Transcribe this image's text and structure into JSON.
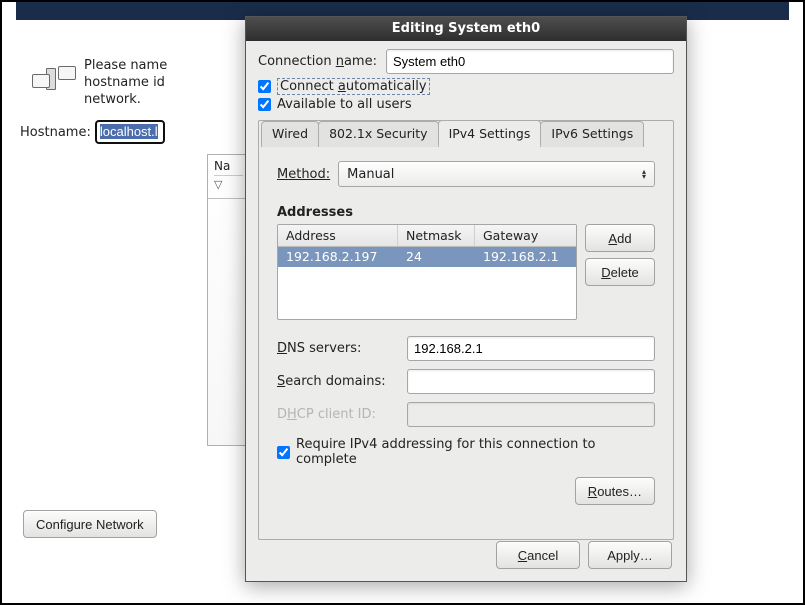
{
  "installer": {
    "text_line1": "Please name",
    "text_line2": "hostname id",
    "text_line3": "network.",
    "hostname_label": "Hostname:",
    "hostname_value": "localhost.l",
    "configure_btn": "Configure Network",
    "subwin_head1": "Na",
    "subwin_head2": "▽"
  },
  "dialog": {
    "title": "Editing System eth0",
    "conn_name_label": "Connection name:",
    "conn_name_value": "System eth0",
    "connect_auto_label": "Connect automatically",
    "connect_auto": true,
    "avail_all_label": "Available to all users",
    "avail_all": true,
    "tabs": [
      "Wired",
      "802.1x Security",
      "IPv4 Settings",
      "IPv6 Settings"
    ],
    "active_tab": "IPv4 Settings",
    "method_label": "Method:",
    "method_value": "Manual",
    "addresses_label": "Addresses",
    "cols": {
      "address": "Address",
      "netmask": "Netmask",
      "gateway": "Gateway"
    },
    "rows": [
      {
        "address": "192.168.2.197",
        "netmask": "24",
        "gateway": "192.168.2.1"
      }
    ],
    "add_btn": "Add",
    "delete_btn": "Delete",
    "dns_label": "DNS servers:",
    "dns_value": "192.168.2.1",
    "search_label": "Search domains:",
    "search_value": "",
    "dhcp_label": "DHCP client ID:",
    "dhcp_value": "",
    "require_label": "Require IPv4 addressing for this connection to complete",
    "require_checked": true,
    "routes_btn": "Routes…",
    "cancel_btn": "Cancel",
    "apply_btn": "Apply…"
  }
}
